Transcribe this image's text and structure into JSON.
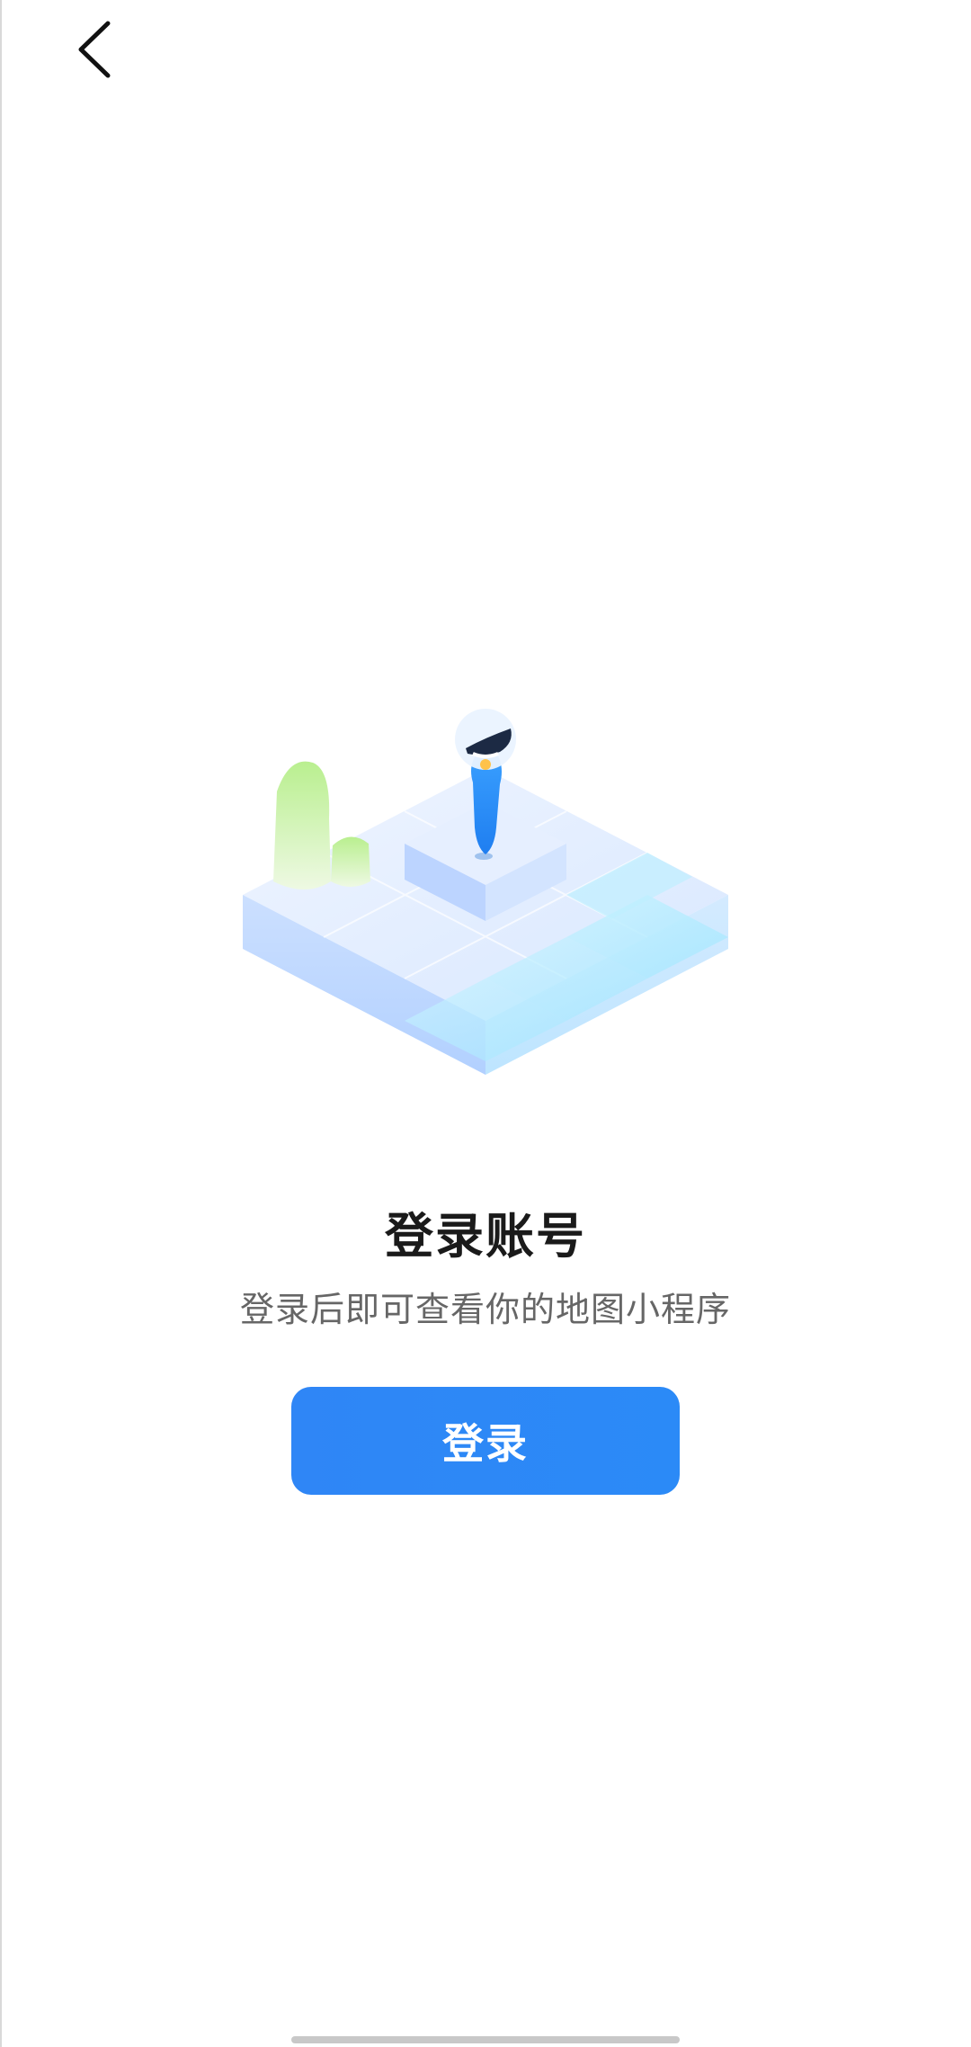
{
  "nav": {
    "back_icon": "chevron-left-icon"
  },
  "main": {
    "illustration": "isometric-map-blocks-illustration",
    "title": "登录账号",
    "subtitle": "登录后即可查看你的地图小程序",
    "login_button_label": "登录"
  },
  "colors": {
    "primary": "#2f86f6",
    "title": "#1a1a1a",
    "subtitle": "#666666",
    "background": "#ffffff"
  }
}
